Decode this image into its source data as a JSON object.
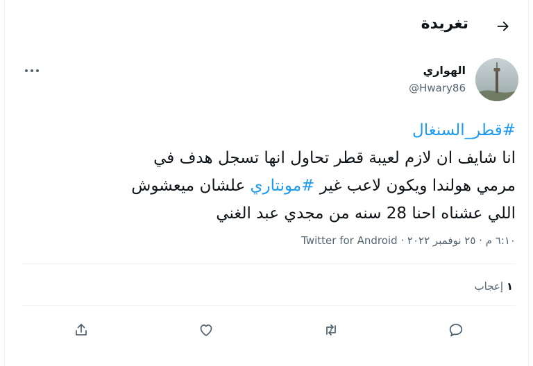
{
  "header": {
    "title": "تغريدة",
    "back_icon": "arrow-right-icon"
  },
  "author": {
    "name": "الهواري",
    "handle": "@Hwary86",
    "avatar_icon": "cairo-tower-photo"
  },
  "tweet": {
    "hashtag_1": "#قطر_السنغال",
    "line_1": "انا شايف ان لازم لعيبة قطر تحاول انها تسجل هدف في",
    "line_2_start": "مرمي هولندا ويكون لاعب غير ",
    "hashtag_2": "#مونتاري",
    "line_2_end": " علشان ميعشوش",
    "line_3": "اللي عشناه احنا 28 سنه من مجدي عبد الغني"
  },
  "meta": {
    "time": "٦:١٠ م",
    "separator": " · ",
    "date": "٢٥ نوفمبر ٢٠٢٢",
    "client": "Twitter for Android"
  },
  "likes": {
    "count": "١",
    "label": "إعجاب"
  },
  "actions": {
    "reply_icon": "comment-icon",
    "retweet_icon": "retweet-icon",
    "like_icon": "heart-icon",
    "share_icon": "share-icon"
  },
  "colors": {
    "accent": "#1d9bf0",
    "secondary_text": "#536471",
    "divider": "#eff3f4"
  }
}
